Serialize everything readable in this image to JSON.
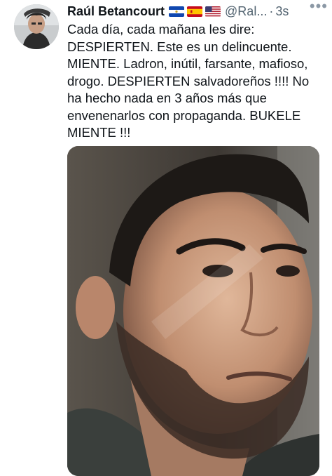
{
  "tweet": {
    "author": {
      "name": "Raúl Betancourt",
      "handle": "@Ral...",
      "flags": [
        "flag-el-salvador-icon",
        "flag-spain-icon",
        "flag-usa-icon"
      ]
    },
    "separator": "·",
    "time": "3s",
    "more_label": "•••",
    "text": "Cada día, cada mañana les dire: DESPIERTEN. Este es un delincuente. MIENTE. Ladron, inútil, farsante, mafioso, drogo. DESPIERTEN salvadoreños !!!! No ha hecho nada en 3 años más que envenenarlos con propaganda. BUKELE MIENTE !!!",
    "media": {
      "type": "photo",
      "subject": "portrait-photo"
    }
  },
  "colors": {
    "text_primary": "#0f1419",
    "text_secondary": "#536471",
    "background": "#ffffff"
  }
}
